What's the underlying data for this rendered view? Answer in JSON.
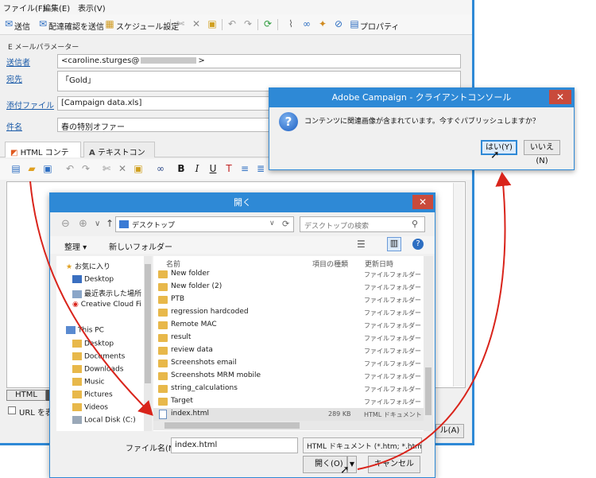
{
  "main": {
    "menu": [
      "ファイル(F)",
      "編集(E)",
      "表示(V)"
    ],
    "toolbar": {
      "send": "送信",
      "send_proof": "配達確認を送信",
      "schedule": "スケジュール設定",
      "properties": "プロパティ"
    },
    "params_title": "E メールパラメーター",
    "fields": {
      "sender_label": "送信者",
      "sender_value": "<caroline.sturges@",
      "sender_value_end": ">",
      "to_label": "宛先",
      "to_value": "「Gold」",
      "attachment_label": "添付ファイル",
      "attachment_value": "[Campaign data.xls]",
      "subject_label": "件名",
      "subject_value": "春の特別オファー"
    },
    "tabs": {
      "html": "HTML コンテンツ",
      "text": "テキストコンテンツ"
    },
    "bottom": {
      "html_tab": "HTML",
      "url_checkbox": "URL を表",
      "fragment_button": "ル(A)"
    }
  },
  "adobe_dialog": {
    "title": "Adobe Campaign - クライアントコンソール",
    "message": "コンテンツに関連画像が含まれています。今すぐパブリッシュしますか？",
    "yes": "はい(Y)",
    "no": "いいえ(N)"
  },
  "open_dialog": {
    "title": "開く",
    "breadcrumb": "デスクトップ",
    "search_placeholder": "デスクトップの検索",
    "organize": "整理 ▾",
    "new_folder": "新しいフォルダー",
    "columns": {
      "name": "名前",
      "type": "項目の種類",
      "date": "更新日時"
    },
    "nav": {
      "favorites": "お気に入り",
      "desktop": "Desktop",
      "recent": "最近表示した場所",
      "creative_cloud": "Creative Cloud Fi",
      "this_pc": "This PC",
      "pc_desktop": "Desktop",
      "documents": "Documents",
      "downloads": "Downloads",
      "music": "Music",
      "pictures": "Pictures",
      "videos": "Videos",
      "local_disk": "Local Disk (C:)"
    },
    "files": [
      {
        "name": "New folder",
        "type": "ファイルフォルダー"
      },
      {
        "name": "New folder (2)",
        "type": "ファイルフォルダー"
      },
      {
        "name": "PTB",
        "type": "ファイルフォルダー"
      },
      {
        "name": "regression hardcoded",
        "type": "ファイルフォルダー"
      },
      {
        "name": "Remote MAC",
        "type": "ファイルフォルダー"
      },
      {
        "name": "result",
        "type": "ファイルフォルダー"
      },
      {
        "name": "review data",
        "type": "ファイルフォルダー"
      },
      {
        "name": "Screenshots email",
        "type": "ファイルフォルダー"
      },
      {
        "name": "Screenshots MRM mobile",
        "type": "ファイルフォルダー"
      },
      {
        "name": "string_calculations",
        "type": "ファイルフォルダー"
      },
      {
        "name": "Target",
        "type": "ファイルフォルダー"
      }
    ],
    "selected_file": {
      "name": "index.html",
      "size": "289 KB",
      "type": "HTML ドキュメント"
    },
    "filename_label": "ファイル名(N):",
    "filename_value": "index.html",
    "filetype": "HTML ドキュメント (*.htm; *.html",
    "open_button": "開く(O)",
    "cancel_button": "キャンセル"
  },
  "colors": {
    "title_blue": "#2e89d6",
    "arrow_red": "#d9241b",
    "close_red": "#c94a3b"
  }
}
